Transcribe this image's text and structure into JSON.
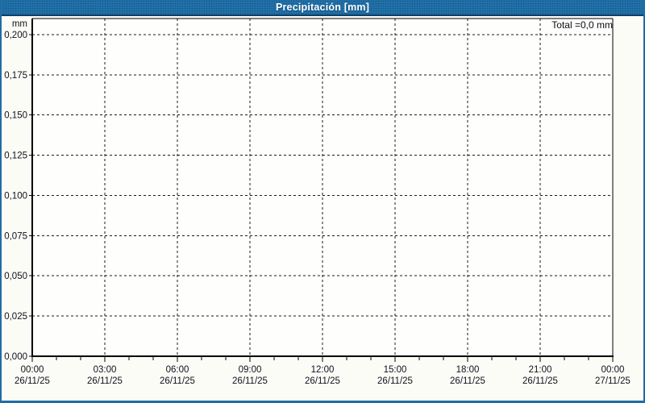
{
  "window": {
    "title": "Precipitación [mm]"
  },
  "summary": {
    "total_label": "Total =0,0 mm"
  },
  "chart_data": {
    "type": "bar",
    "title": "Precipitación [mm]",
    "unit": "mm",
    "total_shown": "Total =0,0 mm",
    "total_value_mm": 0.0,
    "grid": {
      "style": "dashed",
      "horizontal": true,
      "vertical": true
    },
    "legend_position": "none",
    "y_axis": {
      "unit_label": "mm",
      "min": 0,
      "max": 0.21,
      "tick_step": 0.025,
      "tick_labels": [
        "0,200",
        "0,175",
        "0,150",
        "0,125",
        "0,100",
        "0,075",
        "0,050",
        "0,025",
        "0,000"
      ],
      "tick_values": [
        0.2,
        0.175,
        0.15,
        0.125,
        0.1,
        0.075,
        0.05,
        0.025,
        0.0
      ]
    },
    "x_axis": {
      "span_hours": 24,
      "major_tick_hours": 3,
      "minor_tick_hours": 1,
      "tick_labels": [
        {
          "time": "00:00",
          "date": "26/11/25"
        },
        {
          "time": "03:00",
          "date": "26/11/25"
        },
        {
          "time": "06:00",
          "date": "26/11/25"
        },
        {
          "time": "09:00",
          "date": "26/11/25"
        },
        {
          "time": "12:00",
          "date": "26/11/25"
        },
        {
          "time": "15:00",
          "date": "26/11/25"
        },
        {
          "time": "18:00",
          "date": "26/11/25"
        },
        {
          "time": "21:00",
          "date": "26/11/25"
        },
        {
          "time": "00:00",
          "date": "27/11/25"
        }
      ]
    },
    "series": [
      {
        "name": "Precipitación [mm]",
        "values": []
      }
    ]
  },
  "colors": {
    "titlebar": "#2171a9",
    "titlebar_border": "#0e3f66",
    "window_border": "#1f6ca6",
    "background": "#fcfcf7",
    "plot_background": "#fefefc",
    "axis": "#000000",
    "grid": "#1a1a1a",
    "label_text": "#10101c",
    "title_text": "#ffffff"
  }
}
